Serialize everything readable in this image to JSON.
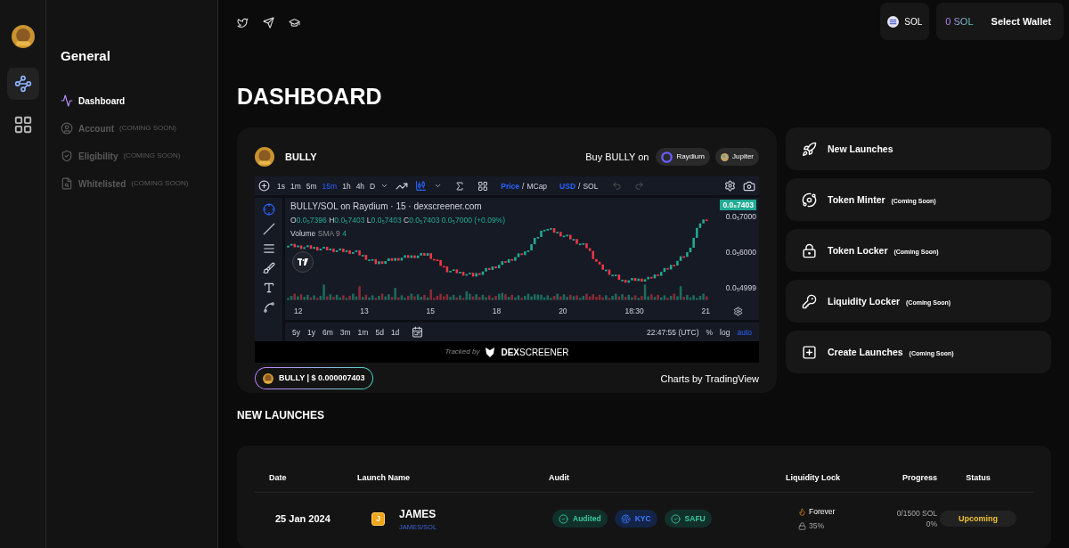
{
  "rail": {
    "items": [
      {
        "kind": "network",
        "selected": true
      },
      {
        "kind": "grid",
        "selected": false
      }
    ]
  },
  "network": {
    "label": "SOL"
  },
  "wallet": {
    "balance": "0 SOL",
    "button": "Select Wallet"
  },
  "sidebar": {
    "title": "General",
    "items": [
      {
        "label": "Dashboard",
        "kind": "dashboard",
        "selected": true
      },
      {
        "label": "Account",
        "note": "(COMING SOON)",
        "kind": "account",
        "selected": false
      },
      {
        "label": "Eligibility",
        "note": "(COMING SOON)",
        "kind": "eligibility",
        "selected": false
      },
      {
        "label": "Whitelisted",
        "note": "(COMING SOON)",
        "kind": "whitelist",
        "selected": false
      }
    ]
  },
  "page_title": "DASHBOARD",
  "token_card": {
    "name": "BULLY",
    "buy_label": "Buy BULLY on",
    "exchanges": [
      {
        "label": "Raydium",
        "kind": "raydium"
      },
      {
        "label": "Jupiter",
        "kind": "jupiter"
      }
    ],
    "chart": {
      "intervals": [
        {
          "label": "1s",
          "selected": false
        },
        {
          "label": "1m",
          "selected": false
        },
        {
          "label": "5m",
          "selected": false
        },
        {
          "label": "15m",
          "selected": true
        },
        {
          "label": "1h",
          "selected": false
        },
        {
          "label": "4h",
          "selected": false
        },
        {
          "label": "D",
          "selected": false
        }
      ],
      "value_modes": {
        "separator": "/",
        "items": [
          {
            "label": "Price",
            "selected": true
          },
          {
            "label": "MCap",
            "selected": false
          }
        ]
      },
      "currencies": {
        "separator": "/",
        "items": [
          {
            "label": "USD",
            "selected": true
          },
          {
            "label": "SOL",
            "selected": false
          }
        ]
      },
      "legend_title": "BULLY/SOL on Raydium · 15 · dexscreener.com",
      "ohlc": [
        {
          "key": "O",
          "value": "0.0₅7396"
        },
        {
          "key": "H",
          "value": "0.0₅7403"
        },
        {
          "key": "L",
          "value": "0.0₅7403"
        },
        {
          "key": "C",
          "value": "0.0₅7403"
        }
      ],
      "change": "0.0₅7000 (+0.09%)",
      "volume": {
        "label": "Volume",
        "sma": "SMA 9",
        "value": "4"
      },
      "price_tag": "0.0₅7403",
      "y_labels": [
        "0.0₅7000",
        "0.0₅6000",
        "0.0₅4999"
      ],
      "x_labels": [
        "12",
        "13",
        "15",
        "18",
        "20",
        "18:30",
        "21"
      ],
      "ranges": [
        "5y",
        "1y",
        "6m",
        "3m",
        "1m",
        "5d",
        "1d"
      ],
      "time": "22:47:55 (UTC)",
      "scales": [
        {
          "label": "%",
          "selected": false
        },
        {
          "label": "log",
          "selected": false
        },
        {
          "label": "auto",
          "selected": true
        }
      ]
    },
    "tracked": {
      "prefix": "Tracked by",
      "brand_a": "DEX",
      "brand_b": "SCREENER"
    },
    "price_pill": "BULLY | $ 0.000007403",
    "credit": "Charts by TradingView"
  },
  "actions": [
    {
      "label": "New Launches",
      "kind": "rocket"
    },
    {
      "label": "Token Minter",
      "note": "(Coming Soon)",
      "kind": "minter"
    },
    {
      "label": "Token Locker",
      "note": "(Coming Soon)",
      "kind": "locker"
    },
    {
      "label": "Liquidity Locker",
      "note": "(Coming Soon)",
      "kind": "liquidity"
    },
    {
      "label": "Create Launches",
      "note": "(Coming Soon)",
      "kind": "create"
    }
  ],
  "section_title": "NEW LAUNCHES",
  "table": {
    "columns": [
      "Date",
      "Launch Name",
      "Audit",
      "Liquidity Lock",
      "Progress",
      "Status"
    ],
    "rows": [
      {
        "date": "25 Jan 2024",
        "logo": "J",
        "name": "JAMES",
        "pair": "JAMES/SOL",
        "audits": [
          {
            "label": "Audited",
            "kind": "check"
          },
          {
            "label": "KYC",
            "kind": "kyc"
          },
          {
            "label": "SAFU",
            "kind": "check"
          }
        ],
        "lock": "Forever",
        "lock_pct": "35%",
        "progress": "0/1500 SOL",
        "progress_pct": "0%",
        "status": "Upcoming"
      }
    ]
  }
}
